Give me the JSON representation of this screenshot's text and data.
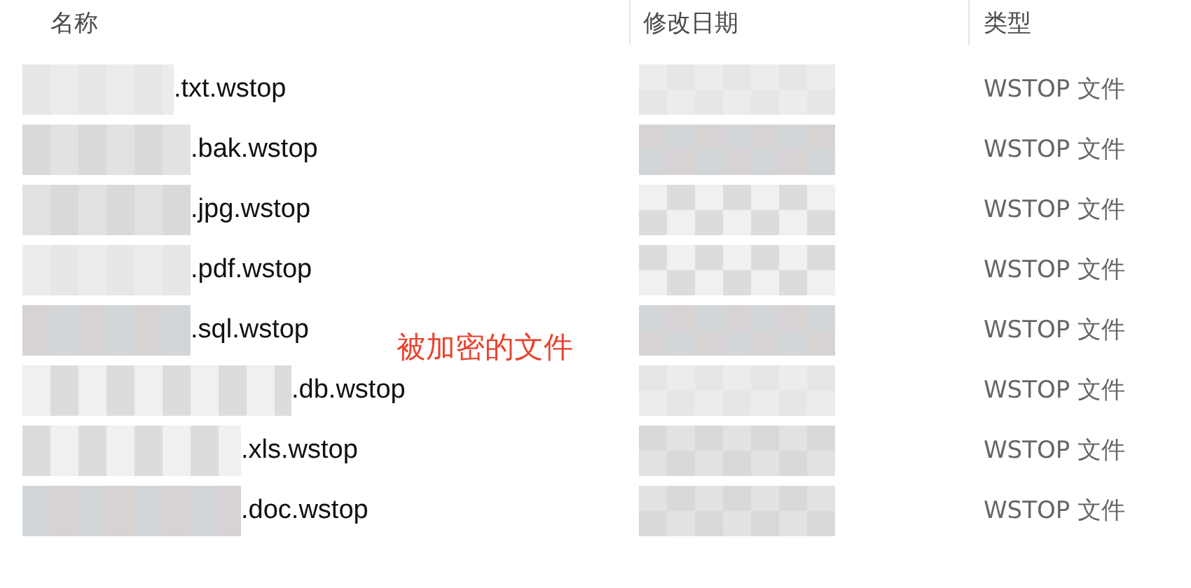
{
  "columns": [
    {
      "label": "名称"
    },
    {
      "label": "修改日期"
    },
    {
      "label": "类型"
    }
  ],
  "rows": [
    {
      "name": ".txt.wstop",
      "type": "WSTOP 文件"
    },
    {
      "name": ".bak.wstop",
      "type": "WSTOP 文件"
    },
    {
      "name": ".jpg.wstop",
      "type": "WSTOP 文件"
    },
    {
      "name": ".pdf.wstop",
      "type": "WSTOP 文件"
    },
    {
      "name": ".sql.wstop",
      "type": "WSTOP 文件"
    },
    {
      "name": ".db.wstop",
      "type": "WSTOP 文件"
    },
    {
      "name": ".xls.wstop",
      "type": "WSTOP 文件"
    },
    {
      "name": ".doc.wstop",
      "type": "WSTOP 文件"
    }
  ],
  "annotation": "被加密的文件"
}
